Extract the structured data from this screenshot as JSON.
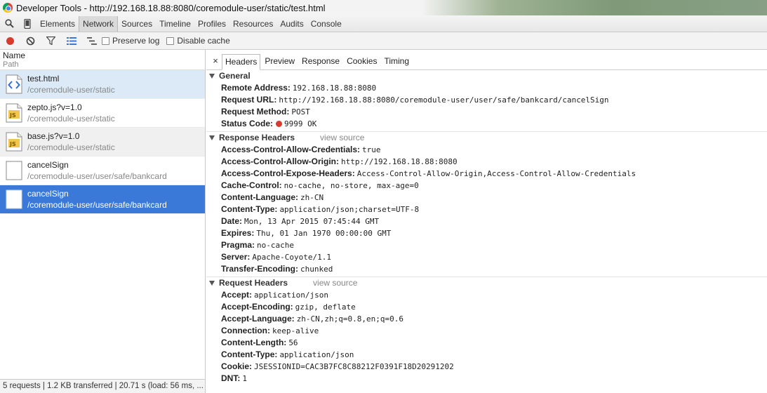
{
  "window": {
    "title": "Developer Tools - http://192.168.18.88:8080/coremodule-user/static/test.html"
  },
  "main_tabs": [
    "Elements",
    "Network",
    "Sources",
    "Timeline",
    "Profiles",
    "Resources",
    "Audits",
    "Console"
  ],
  "toolbar": {
    "preserve_log": "Preserve log",
    "disable_cache": "Disable cache"
  },
  "left": {
    "header_name": "Name",
    "header_path": "Path",
    "requests": [
      {
        "name": "test.html",
        "path": "/coremodule-user/static",
        "icon": "html-file-icon"
      },
      {
        "name": "zepto.js?v=1.0",
        "path": "/coremodule-user/static",
        "icon": "js-file-icon"
      },
      {
        "name": "base.js?v=1.0",
        "path": "/coremodule-user/static",
        "icon": "js-file-icon"
      },
      {
        "name": "cancelSign",
        "path": "/coremodule-user/user/safe/bankcard",
        "icon": "blank-file-icon"
      },
      {
        "name": "cancelSign",
        "path": "/coremodule-user/user/safe/bankcard",
        "icon": "blank-file-icon"
      }
    ],
    "footer": "5 requests | 1.2 KB transferred | 20.71 s (load: 56 ms, ..."
  },
  "detail_tabs": {
    "close": "×",
    "tabs": [
      "Headers",
      "Preview",
      "Response",
      "Cookies",
      "Timing"
    ]
  },
  "general": {
    "title": "General",
    "rows": [
      {
        "k": "Remote Address:",
        "v": "192.168.18.88:8080"
      },
      {
        "k": "Request URL:",
        "v": "http://192.168.18.88:8080/coremodule-user/user/safe/bankcard/cancelSign"
      },
      {
        "k": "Request Method:",
        "v": "POST"
      },
      {
        "k": "Status Code:",
        "v": "9999 OK"
      }
    ]
  },
  "response_headers": {
    "title": "Response Headers",
    "view_source": "view source",
    "rows": [
      {
        "k": "Access-Control-Allow-Credentials:",
        "v": "true"
      },
      {
        "k": "Access-Control-Allow-Origin:",
        "v": "http://192.168.18.88:8080"
      },
      {
        "k": "Access-Control-Expose-Headers:",
        "v": "Access-Control-Allow-Origin,Access-Control-Allow-Credentials"
      },
      {
        "k": "Cache-Control:",
        "v": "no-cache, no-store, max-age=0"
      },
      {
        "k": "Content-Language:",
        "v": "zh-CN"
      },
      {
        "k": "Content-Type:",
        "v": "application/json;charset=UTF-8"
      },
      {
        "k": "Date:",
        "v": "Mon, 13 Apr 2015 07:45:44 GMT"
      },
      {
        "k": "Expires:",
        "v": "Thu, 01 Jan 1970 00:00:00 GMT"
      },
      {
        "k": "Pragma:",
        "v": "no-cache"
      },
      {
        "k": "Server:",
        "v": "Apache-Coyote/1.1"
      },
      {
        "k": "Transfer-Encoding:",
        "v": "chunked"
      }
    ]
  },
  "request_headers": {
    "title": "Request Headers",
    "view_source": "view source",
    "rows": [
      {
        "k": "Accept:",
        "v": "application/json"
      },
      {
        "k": "Accept-Encoding:",
        "v": "gzip, deflate"
      },
      {
        "k": "Accept-Language:",
        "v": "zh-CN,zh;q=0.8,en;q=0.6"
      },
      {
        "k": "Connection:",
        "v": "keep-alive"
      },
      {
        "k": "Content-Length:",
        "v": "56"
      },
      {
        "k": "Content-Type:",
        "v": "application/json"
      },
      {
        "k": "Cookie:",
        "v": "JSESSIONID=CAC3B7FC8C88212F0391F18D20291202"
      },
      {
        "k": "DNT:",
        "v": "1"
      }
    ]
  },
  "colors": {
    "selected_row": "#3a79d8",
    "record_red": "#d83a2b",
    "status_dot": "#d83a2b"
  }
}
